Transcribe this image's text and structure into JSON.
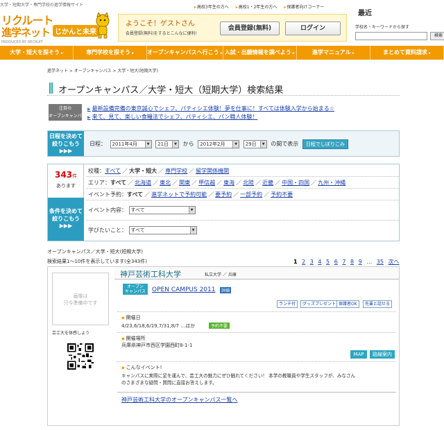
{
  "header": {
    "tagline": "大学・短期大学・専門学校の進学情報サイト",
    "logo_line1": "リクルート",
    "logo_line2": "進学ネット",
    "logo_badge": "じかんと未来",
    "logo_sub": "PRODUCED BY RECRUIT",
    "welcome": "ようこそ！ゲストさん",
    "welcome_sub": "会員登録(無料)をするとこんなに便利!",
    "register_label": "会員登録(無料)",
    "login_label": "ログイン",
    "top_links": [
      "高校3年生の方へ",
      "高校1・2年生の方へ",
      "保護者向けコーナー"
    ],
    "search_title": "最近",
    "search_label": "学校名・キーワードから探す",
    "search_button": "検索"
  },
  "nav": [
    "大学・短大を探そう",
    "専門学校を探そう",
    "オープンキャンパスへ行こう",
    "入試・出願情報を調べよう",
    "進学マニュアル",
    "まとめて資料請求"
  ],
  "breadcrumb": "進学ネット > オープンキャンパス > 大学・短大(短期大学)",
  "page_title": "オープンキャンパス／大学・短大（短期大学）検索結果",
  "pickup": {
    "label_l1": "注目の",
    "label_l2": "オープンキャンパス",
    "items": [
      "最新設備完備の東京誠心でシェフ、パティシエ体験！夢を仕事に！すべては体験入学から始まる☆",
      "来て、見て、楽しい食糧法でシェフ、パティシエ、パン職人体験！"
    ]
  },
  "date_filter": {
    "label_l1": "日程を決めて",
    "label_l2": "絞りこもう",
    "arrows": "▶▶▶",
    "prefix": "日程：",
    "from_month": "2011年4月",
    "from_day": "21日",
    "to_word": "から",
    "to_month": "2012年2月",
    "to_day": "29日",
    "suffix": "の間で表示",
    "button": "日程でしぼりこみ"
  },
  "filter": {
    "count": "343",
    "count_unit": "件",
    "count_suffix": "あります",
    "label_l1": "条件を決めて",
    "label_l2": "絞りこもう",
    "arrows": "▶▶▶",
    "school_label": "校種：",
    "school_all": "すべて",
    "school_current": "大学・短大",
    "school_items": [
      "専門学校",
      "留学関係機関"
    ],
    "area_label": "エリア：",
    "area_current": "すべて",
    "area_items": [
      "北海道",
      "東北",
      "関東",
      "甲信越",
      "東海",
      "北陸",
      "近畿",
      "中国・四国",
      "九州・沖縄"
    ],
    "event_label": "イベント予約：",
    "event_current": "すべて",
    "event_items": [
      "進学ネットで予約可能",
      "要予約",
      "一部予約",
      "予約不要"
    ],
    "content_label": "イベント内容：",
    "content_value": "すべて",
    "study_label": "学びたいこと：",
    "study_value": "すべて"
  },
  "results": {
    "subhead": "オープンキャンパス／大学・短大(短期大学)",
    "count_line": "検索結果1〜10件を表示しています(全343件)",
    "pages": [
      "1",
      "2",
      "3",
      "4",
      "5",
      "6",
      "7",
      "8",
      "9",
      "…",
      "35",
      "次へ"
    ],
    "current_page": "1",
    "card": {
      "thumb_text_l1": "画像は",
      "thumb_text_l2": "只今準備中です",
      "thumb_caption": "芸工大を体感しよう",
      "school_name": "神戸芸術工科大学",
      "school_type": "私立大学 ／ 兵庫",
      "oc_badge_l1": "オープン",
      "oc_badge_l2": "キャンパス",
      "oc_title": "OPEN CAMPUS 2011",
      "oc_detail": "詳細",
      "tags": [
        "ランチ付",
        "グッズプレゼント",
        "保護者OK",
        "先輩と話せる"
      ],
      "date_head": "開催日",
      "date_text": "4/23,6/18,6/19,7/31,8/7 …ほか",
      "reservation": "予約不要",
      "place_head": "開催場所",
      "place_text": "兵庫県神戸市西区学園西町8-1-1",
      "map_button": "MAP",
      "route_button": "路線案内",
      "event_head": "こんなイベント!",
      "event_text_l1": "キャンパスに実際に足を運んで、芸工大の魅力にぜひ触れてください！ 本学の教職員や学生スタッフが、みなさん",
      "event_text_l2": "のさまざまな疑問・質問に直接お答えします。",
      "more_link": "神戸芸術工科大学のオープンキャンパス一覧へ"
    }
  }
}
